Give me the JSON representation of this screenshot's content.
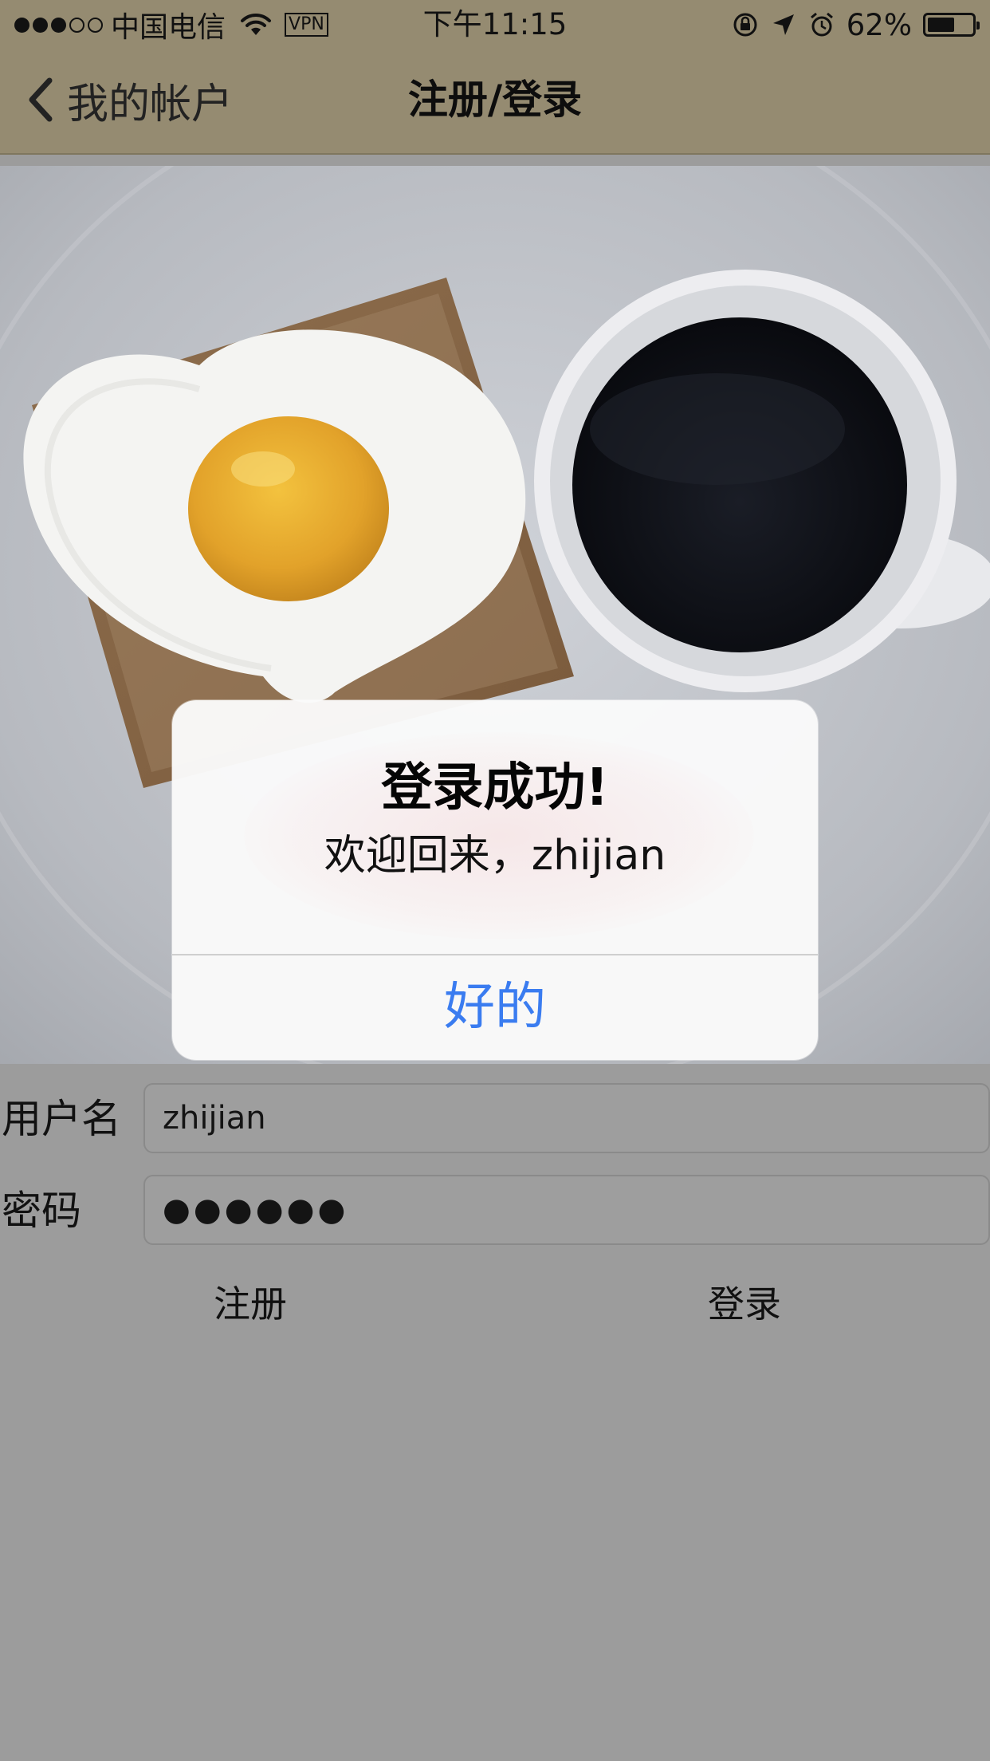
{
  "status_bar": {
    "carrier": "中国电信",
    "vpn": "VPN",
    "time": "下午11:15",
    "battery_percent": "62%",
    "battery_level": 0.62,
    "signal_bars_filled": 3,
    "signal_bars_total": 5,
    "icons": [
      "wifi-icon",
      "rotation-lock-icon",
      "location-arrow-icon",
      "alarm-icon",
      "battery-icon"
    ]
  },
  "nav": {
    "back_label": "我的帐户",
    "title": "注册/登录"
  },
  "form": {
    "username_label": "用户名",
    "username_value": "zhijian",
    "password_label": "密码",
    "password_value": "●●●●●●"
  },
  "actions": {
    "register_label": "注册",
    "login_label": "登录"
  },
  "alert": {
    "title": "登录成功!",
    "message": "欢迎回来，zhijian",
    "ok_label": "好的"
  },
  "colors": {
    "nav_background": "#958b71",
    "alert_button_blue": "#3a7cf0",
    "page_background": "#9c9c9c"
  }
}
